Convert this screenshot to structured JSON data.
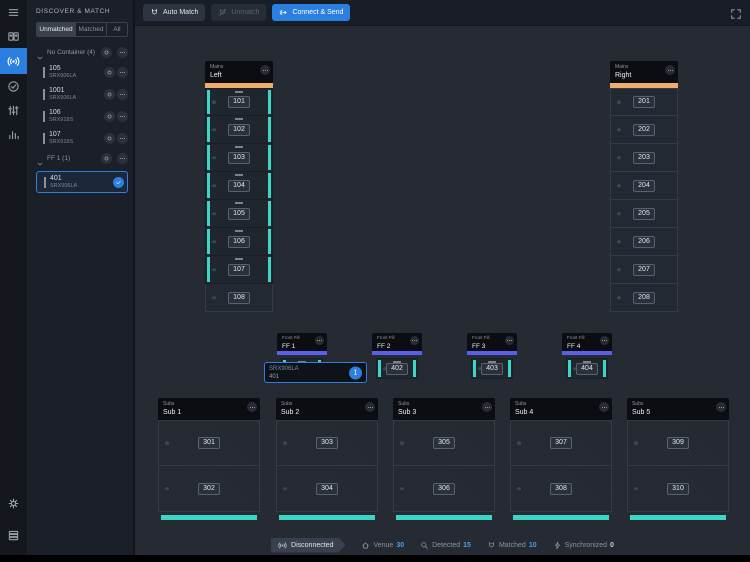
{
  "colors": {
    "accent_blue": "#2d7fe0",
    "teal": "#3cd6c6",
    "orange": "#efad6d",
    "purple": "#5a5fe8",
    "stat_value_blue": "#4f9fe8"
  },
  "rail": {
    "items": [
      {
        "icon": "menu-icon",
        "active": false
      },
      {
        "icon": "venue-icon",
        "active": false
      },
      {
        "icon": "discover-icon",
        "active": true
      },
      {
        "icon": "check-circle-icon",
        "active": false
      },
      {
        "icon": "tune-icon",
        "active": false
      },
      {
        "icon": "levels-icon",
        "active": false
      }
    ],
    "bottom_items": [
      {
        "icon": "settings-gear-icon"
      },
      {
        "icon": "log-icon"
      }
    ]
  },
  "panel": {
    "title": "DISCOVER & MATCH",
    "tabs": [
      {
        "label": "Unmatched",
        "active": true
      },
      {
        "label": "Matched",
        "active": false
      },
      {
        "label": "All",
        "active": false
      }
    ],
    "groups": [
      {
        "label": "No Container (4)",
        "items": [
          {
            "id": "105",
            "model": "SRX906LA",
            "selected": false
          },
          {
            "id": "1001",
            "model": "SRX906LA",
            "selected": false
          },
          {
            "id": "106",
            "model": "SRX918S",
            "selected": false
          },
          {
            "id": "107",
            "model": "SRX918S",
            "selected": false
          }
        ]
      },
      {
        "label": "FF 1 (1)",
        "items": [
          {
            "id": "401",
            "model": "SRX906LA",
            "selected": true
          }
        ]
      }
    ]
  },
  "toolbar": {
    "buttons": [
      {
        "label": "Auto Match",
        "icon": "magnet-icon",
        "state": "normal"
      },
      {
        "label": "Unmatch",
        "icon": "unmatch-icon",
        "state": "disabled"
      },
      {
        "label": "Connect & Send",
        "icon": "send-arrow-icon",
        "state": "primary"
      }
    ]
  },
  "venue": {
    "mains": [
      {
        "type": "Mains",
        "name": "Left",
        "accent": "orange",
        "modules": [
          {
            "id": "101",
            "matched": true
          },
          {
            "id": "102",
            "matched": true
          },
          {
            "id": "103",
            "matched": true
          },
          {
            "id": "104",
            "matched": true
          },
          {
            "id": "105",
            "matched": true
          },
          {
            "id": "106",
            "matched": true
          },
          {
            "id": "107",
            "matched": true
          },
          {
            "id": "108",
            "matched": false
          }
        ]
      },
      {
        "type": "Mains",
        "name": "Right",
        "accent": "orange",
        "modules": [
          {
            "id": "201",
            "matched": false
          },
          {
            "id": "202",
            "matched": false
          },
          {
            "id": "203",
            "matched": false
          },
          {
            "id": "204",
            "matched": false
          },
          {
            "id": "205",
            "matched": false
          },
          {
            "id": "206",
            "matched": false
          },
          {
            "id": "207",
            "matched": false
          },
          {
            "id": "208",
            "matched": false
          }
        ]
      }
    ],
    "frontfills": [
      {
        "type": "Front Fill",
        "name": "FF 1",
        "accent": "purple",
        "modules": [
          {
            "id": "401",
            "matched": true
          }
        ]
      },
      {
        "type": "Front Fill",
        "name": "FF 2",
        "accent": "purple",
        "modules": [
          {
            "id": "402",
            "matched": true
          }
        ]
      },
      {
        "type": "Front Fill",
        "name": "FF 3",
        "accent": "purple",
        "modules": [
          {
            "id": "403",
            "matched": true
          }
        ]
      },
      {
        "type": "Front Fill",
        "name": "FF 4",
        "accent": "purple",
        "modules": [
          {
            "id": "404",
            "matched": true
          }
        ]
      }
    ],
    "subs": [
      {
        "type": "Subs",
        "name": "Sub 1",
        "front_bar": true,
        "modules": [
          {
            "id": "301",
            "matched": false
          },
          {
            "id": "302",
            "matched": false
          }
        ]
      },
      {
        "type": "Subs",
        "name": "Sub 2",
        "front_bar": true,
        "modules": [
          {
            "id": "303",
            "matched": false
          },
          {
            "id": "304",
            "matched": false
          }
        ]
      },
      {
        "type": "Subs",
        "name": "Sub 3",
        "front_bar": true,
        "modules": [
          {
            "id": "305",
            "matched": false
          },
          {
            "id": "306",
            "matched": false
          }
        ]
      },
      {
        "type": "Subs",
        "name": "Sub 4",
        "front_bar": true,
        "modules": [
          {
            "id": "307",
            "matched": false
          },
          {
            "id": "308",
            "matched": false
          }
        ]
      },
      {
        "type": "Subs",
        "name": "Sub 5",
        "front_bar": true,
        "modules": [
          {
            "id": "309",
            "matched": false
          },
          {
            "id": "310",
            "matched": false
          }
        ]
      }
    ],
    "drag_popup": {
      "model": "SRX906LA",
      "id": "401",
      "count": "1"
    }
  },
  "statusbar": {
    "connection": {
      "icon": "broadcast-icon",
      "label": "Disconnected"
    },
    "stats": [
      {
        "icon": "home-icon",
        "label": "Venue",
        "value": "30",
        "highlight": true
      },
      {
        "icon": "search-icon",
        "label": "Detected",
        "value": "15",
        "highlight": true
      },
      {
        "icon": "magnet-icon",
        "label": "Matched",
        "value": "10",
        "highlight": true
      },
      {
        "icon": "sync-icon",
        "label": "Synchronized",
        "value": "0",
        "highlight": false
      }
    ]
  }
}
